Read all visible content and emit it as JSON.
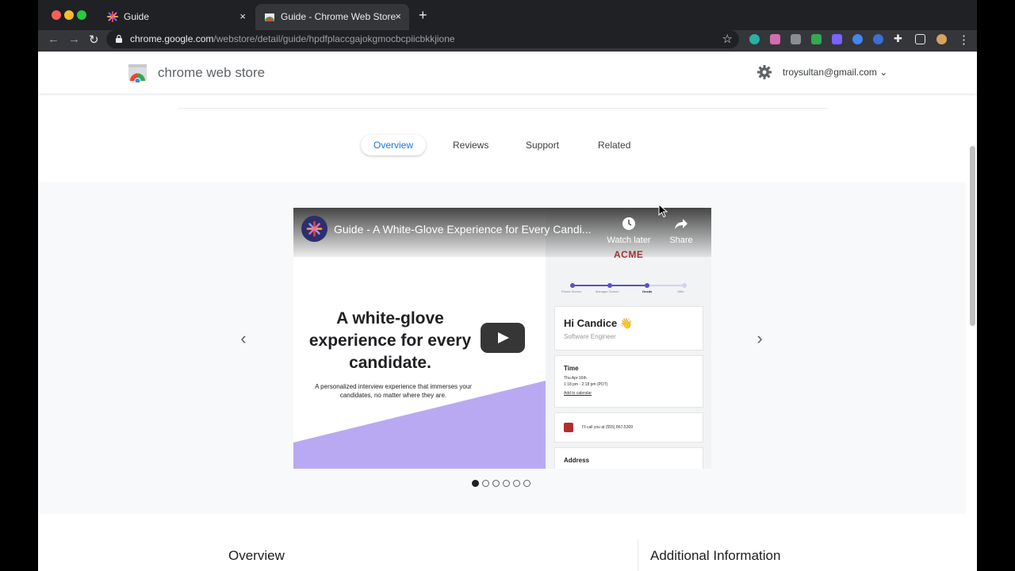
{
  "browser": {
    "tabs": [
      {
        "title": "Guide",
        "active": false
      },
      {
        "title": "Guide - Chrome Web Store",
        "active": true
      }
    ],
    "new_tab_icon": "plus-icon",
    "close_icon": "×",
    "url_host": "chrome.google.com",
    "url_path": "/webstore/detail/guide/hpdfplaccgajokgmocbcpiicbkkjione"
  },
  "header": {
    "store_title": "chrome web store",
    "account_email": "troysultan@gmail.com"
  },
  "nav_tabs": [
    {
      "label": "Overview",
      "active": true
    },
    {
      "label": "Reviews",
      "active": false
    },
    {
      "label": "Support",
      "active": false
    },
    {
      "label": "Related",
      "active": false
    }
  ],
  "video": {
    "title": "Guide - A White-Glove Experience for Every Candi...",
    "watch_later": "Watch later",
    "share": "Share",
    "headline": "A white-glove experience for every candidate.",
    "subline": "A personalized interview experience that immerses your candidates, no matter where they are.",
    "company_logo": "ACME",
    "steps": [
      "Phone Screen",
      "Manager Screen",
      "Onsite",
      "Offer"
    ],
    "greeting": "Hi Candice 👋",
    "role": "Software Engineer",
    "time_label": "Time",
    "time_date": "Thu Apr 16th",
    "time_range": "1:18 pm - 2:18 pm (PDT)",
    "add_calendar": "Add to calendar",
    "call_text": "I'll call you at (555) 867-5309",
    "address_label": "Address",
    "accent_color": "#5b4fcf",
    "purple_color": "#b9a9f2"
  },
  "gallery": {
    "prev": "‹",
    "next": "›",
    "dot_count": 6,
    "active_dot": 1
  },
  "sections": {
    "overview": "Overview",
    "additional": "Additional Information"
  }
}
